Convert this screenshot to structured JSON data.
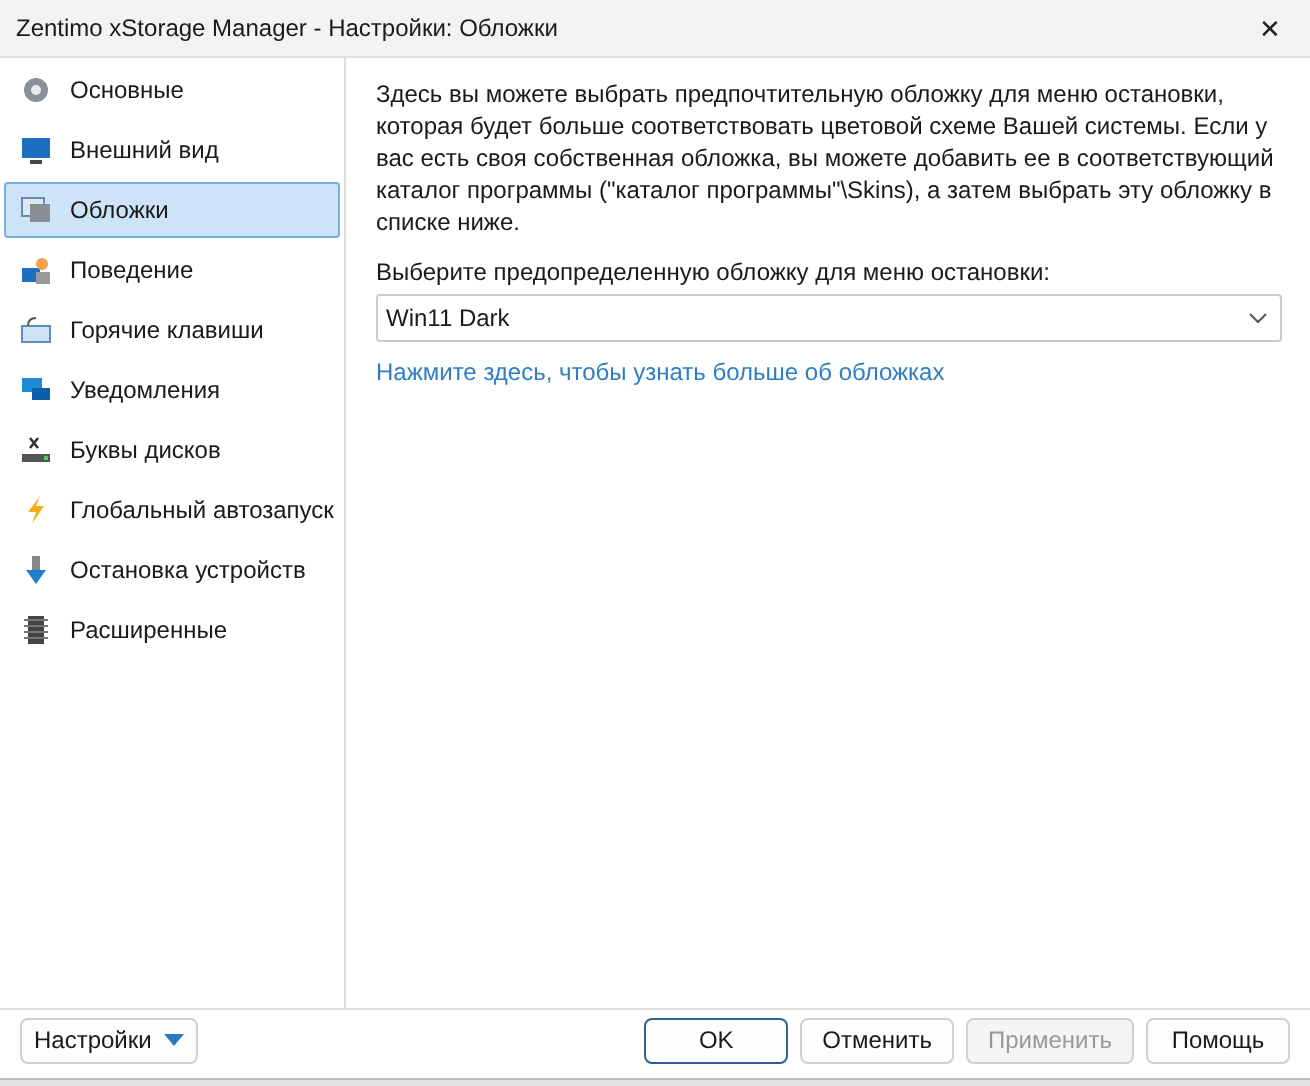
{
  "window": {
    "title": "Zentimo xStorage Manager - Настройки: Обложки",
    "close": "✕"
  },
  "sidebar": {
    "items": [
      {
        "label": "Основные",
        "selected": false
      },
      {
        "label": "Внешний вид",
        "selected": false
      },
      {
        "label": "Обложки",
        "selected": true
      },
      {
        "label": "Поведение",
        "selected": false
      },
      {
        "label": "Горячие клавиши",
        "selected": false
      },
      {
        "label": "Уведомления",
        "selected": false
      },
      {
        "label": "Буквы дисков",
        "selected": false
      },
      {
        "label": "Глобальный автозапуск",
        "selected": false
      },
      {
        "label": "Остановка устройств",
        "selected": false
      },
      {
        "label": "Расширенные",
        "selected": false
      }
    ]
  },
  "content": {
    "description": "Здесь вы можете выбрать предпочтительную обложку для меню остановки, которая будет больше соответствовать цветовой схеме Вашей системы. Если у вас есть своя собственная обложка, вы можете добавить ее в соответствующий каталог программы (\"каталог программы\"\\Skins), а затем выбрать эту обложку в списке ниже.",
    "select_label": "Выберите предопределенную обложку для меню остановки:",
    "select_value": "Win11 Dark",
    "link": "Нажмите здесь, чтобы узнать больше об обложках"
  },
  "footer": {
    "menu_button": "Настройки",
    "buttons": [
      {
        "label": "OK",
        "default": true,
        "disabled": false
      },
      {
        "label": "Отменить",
        "default": false,
        "disabled": false
      },
      {
        "label": "Применить",
        "default": false,
        "disabled": true
      },
      {
        "label": "Помощь",
        "default": false,
        "disabled": false
      }
    ]
  }
}
